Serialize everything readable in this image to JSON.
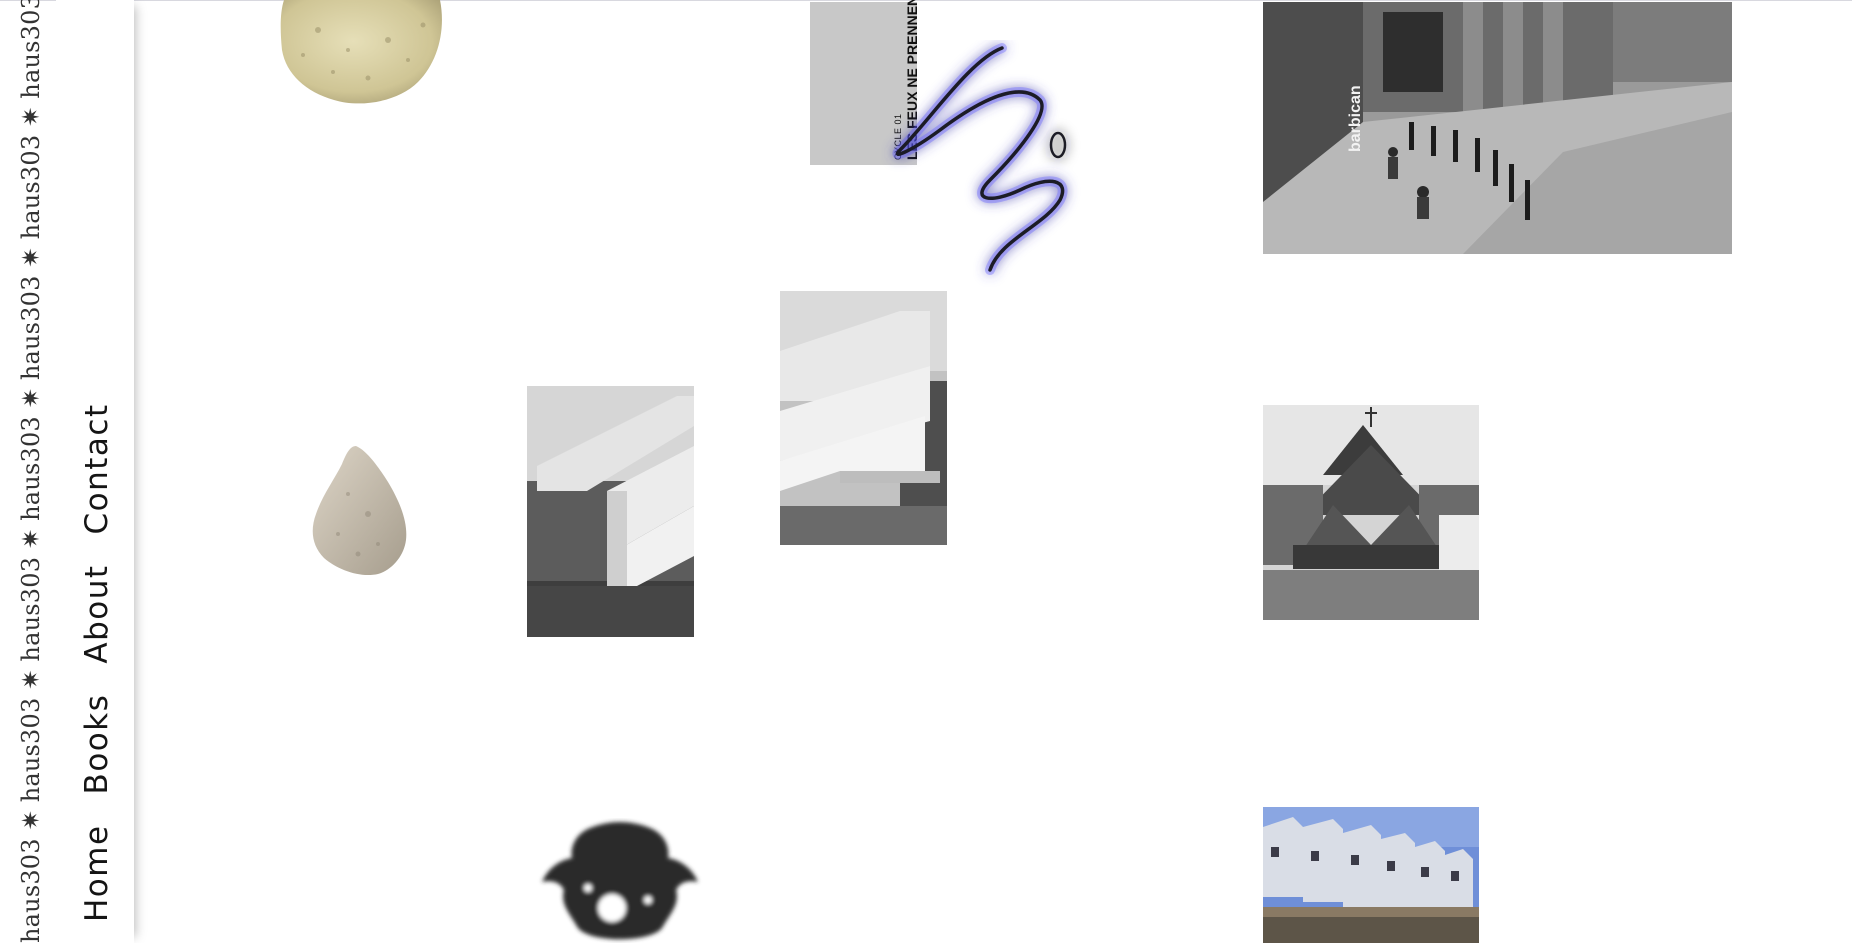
{
  "marquee": {
    "text": "haus303 ✷ haus303 ✷ haus303 ✷ haus303 ✷ haus303 ✷ haus303 ✷ haus303 ✷ haus303 ✷ haus303 ✷ haus303 ✷ haus303 ✷ haus303 ✷ haus303 ✷ haus303 ✷ haus303 ✷ h"
  },
  "nav": {
    "items": [
      {
        "label": "Home"
      },
      {
        "label": "Books"
      },
      {
        "label": "About"
      },
      {
        "label": "Contact"
      }
    ]
  },
  "book": {
    "cycle": "CYCLE 01",
    "title": "LES FEUX NE PRENNENT"
  },
  "barbican_sign": "barbican",
  "colors": {
    "squiggle_glow": "#5b55ff",
    "stone_yellow": "#d8cfa0",
    "stone_gray": "#cbc3b3"
  }
}
